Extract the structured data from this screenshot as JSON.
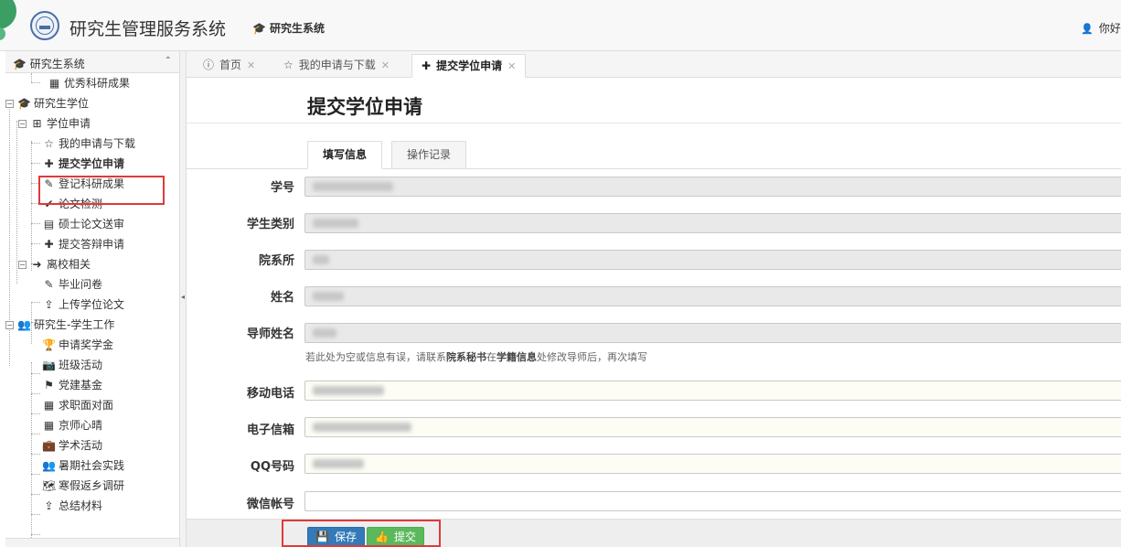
{
  "header": {
    "title": "研究生管理服务系统",
    "nav_label": "研究生系统",
    "user_greeting": "你好"
  },
  "sidebar": {
    "header_label": "研究生系统",
    "items": [
      {
        "label": "优秀科研成果",
        "icon": "table-icon"
      },
      {
        "label": "研究生学位",
        "icon": "graduation-cap-icon"
      },
      {
        "label": "学位申请",
        "icon": "plus-square-icon"
      },
      {
        "label": "我的申请与下载",
        "icon": "star-outline-icon"
      },
      {
        "label": "提交学位申请",
        "icon": "plus-icon"
      },
      {
        "label": "登记科研成果",
        "icon": "pencil-icon"
      },
      {
        "label": "论文检测",
        "icon": "check-icon"
      },
      {
        "label": "硕士论文送审",
        "icon": "book-icon"
      },
      {
        "label": "提交答辩申请",
        "icon": "plus-icon"
      },
      {
        "label": "离校相关",
        "icon": "sign-out-icon"
      },
      {
        "label": "毕业问卷",
        "icon": "pencil-icon"
      },
      {
        "label": "上传学位论文",
        "icon": "upload-icon"
      },
      {
        "label": "研究生-学生工作",
        "icon": "users-icon"
      },
      {
        "label": "申请奖学金",
        "icon": "trophy-icon"
      },
      {
        "label": "班级活动",
        "icon": "camera-icon"
      },
      {
        "label": "党建基金",
        "icon": "flag-icon"
      },
      {
        "label": "求职面对面",
        "icon": "table-icon"
      },
      {
        "label": "京师心晴",
        "icon": "table-icon"
      },
      {
        "label": "学术活动",
        "icon": "briefcase-icon"
      },
      {
        "label": "暑期社会实践",
        "icon": "users-icon"
      },
      {
        "label": "寒假返乡调研",
        "icon": "map-icon"
      },
      {
        "label": "总结材料",
        "icon": "upload-icon"
      }
    ]
  },
  "tabs": [
    {
      "label": "首页",
      "icon": "info-icon"
    },
    {
      "label": "我的申请与下载",
      "icon": "star-outline-icon"
    },
    {
      "label": "提交学位申请",
      "icon": "plus-icon",
      "active": true
    }
  ],
  "main": {
    "title": "提交学位申请",
    "sub_tabs": [
      "填写信息",
      "操作记录"
    ],
    "fields": [
      {
        "label": "学号"
      },
      {
        "label": "学生类别"
      },
      {
        "label": "院系所"
      },
      {
        "label": "姓名"
      },
      {
        "label": "导师姓名"
      },
      {
        "label": "移动电话"
      },
      {
        "label": "电子信箱"
      },
      {
        "label": "QQ号码"
      },
      {
        "label": "微信帐号"
      }
    ],
    "help": {
      "p1": "若此处为空或信息有误，请联系",
      "b1": "院系秘书",
      "p2": "在",
      "b2": "学籍信息",
      "p3": "处修改导师后，再次填写"
    }
  },
  "footer": {
    "save_label": "保存",
    "submit_label": "提交"
  },
  "colors": {
    "highlight": "#e03a3a",
    "save_button": "#337ab7",
    "submit_button": "#5cb85c"
  }
}
